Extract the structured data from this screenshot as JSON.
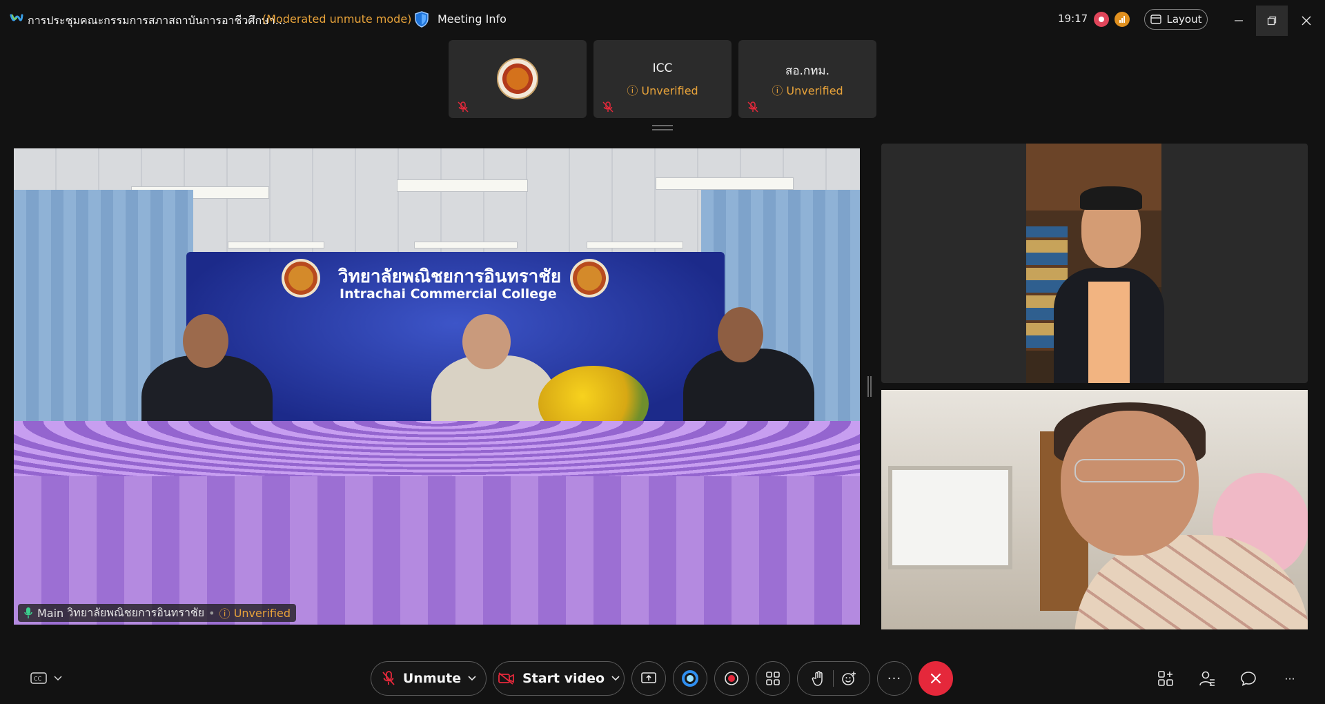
{
  "titlebar": {
    "meeting_title": "การประชุมคณะกรรมการสภาสถาบันการอาชีวศึกษา...",
    "mode": "(Moderated unmute mode)",
    "meeting_info": "Meeting Info",
    "time": "19:17",
    "layout_label": "Layout"
  },
  "thumbnails": [
    {
      "name": "",
      "status": ""
    },
    {
      "name": "ICC",
      "status": "Unverified"
    },
    {
      "name": "สอ.กทม.",
      "status": "Unverified"
    }
  ],
  "main_video": {
    "sign_thai": "วิทยาลัยพณิชยการอินทราชัย",
    "sign_english": "Intrachai Commercial College",
    "label_prefix": "Main",
    "label_name": "วิทยาลัยพณิชยการอินทราชัย",
    "separator": "•",
    "label_status": "Unverified"
  },
  "toolbar": {
    "unmute_label": "Unmute",
    "start_video_label": "Start video",
    "more_label": "···",
    "overflow_label": "···"
  },
  "colors": {
    "warning": "#e8a33a",
    "leave": "#e5283b",
    "mute_red": "#e5283b"
  }
}
